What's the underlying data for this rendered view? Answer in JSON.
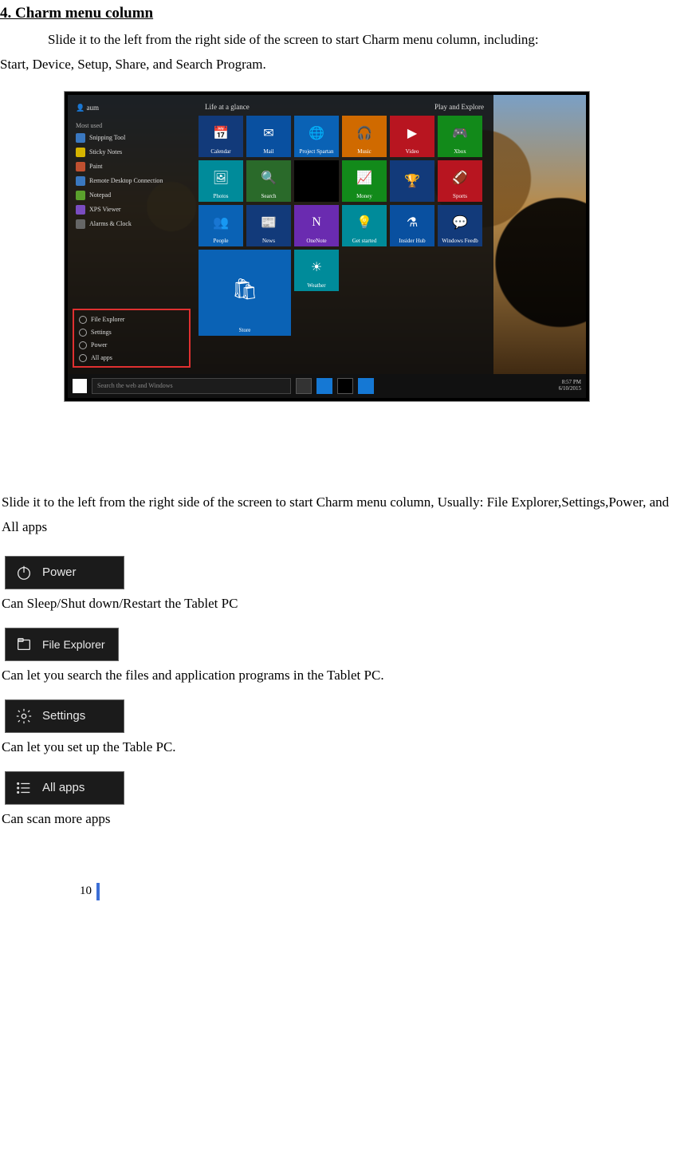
{
  "heading": "4.  Charm menu column",
  "intro1": "Slide it to the left from the right side of the screen to start Charm menu column, including:",
  "intro2": "Start, Device, Setup, Share, and Search Program.",
  "startmenu": {
    "user": "aum",
    "hdr_most": "Most used",
    "left_items": [
      "Snipping Tool",
      "Sticky Notes",
      "Paint",
      "Remote Desktop Connection",
      "Notepad",
      "XPS Viewer",
      "Alarms & Clock"
    ],
    "bottom": [
      "File Explorer",
      "Settings",
      "Power",
      "All apps"
    ],
    "grp1": "Life at a glance",
    "grp2": "Play and Explore",
    "tiles": [
      "Calendar",
      "Mail",
      "Project Spartan",
      "Music",
      "Video",
      "Xbox",
      "Photos",
      "Search",
      "",
      "Money",
      "",
      "Sports",
      "People",
      "News",
      "OneNote",
      "Get started",
      "Insider Hub",
      "Windows Feedb",
      "Store",
      "Weather"
    ],
    "search_ph": "Search the web and Windows",
    "clock": "8:57 PM\n6/10/2015"
  },
  "para_middle": "Slide it to the left from the right side of the screen to start Charm menu column, Usually: File Explorer,Settings,Power, and All apps",
  "chips": {
    "power": "Power",
    "power_desc": "Can Sleep/Shut down/Restart the Tablet PC",
    "file": "File Explorer",
    "file_desc": "Can let you search the files and application programs in the Tablet PC.",
    "settings": "Settings",
    "settings_desc": "Can let you set up the Table PC.",
    "allapps": "All apps",
    "allapps_desc": "Can scan more apps"
  },
  "page_no": "10"
}
